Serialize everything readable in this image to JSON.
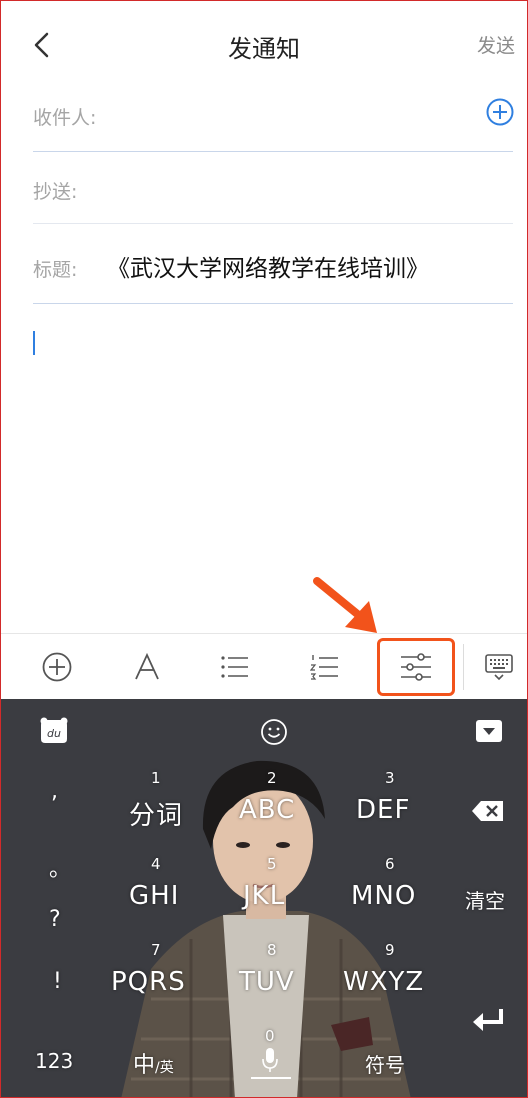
{
  "header": {
    "title": "发通知",
    "send_label": "发送"
  },
  "form": {
    "recipient_label": "收件人:",
    "cc_label": "抄送:",
    "subject_label": "标题:",
    "subject_value": "《武汉大学网络教学在线培训》"
  },
  "toolbar": {
    "icons": [
      "add-circle-icon",
      "font-style-icon",
      "bullet-list-icon",
      "numbered-list-icon",
      "settings-sliders-icon",
      "keyboard-toggle-icon"
    ],
    "highlight_color": "#f2531b"
  },
  "keyboard": {
    "punct": [
      ",",
      "。",
      "?",
      "!"
    ],
    "keys": [
      {
        "num": "1",
        "label": "分词"
      },
      {
        "num": "2",
        "label": "ABC"
      },
      {
        "num": "3",
        "label": "DEF"
      },
      {
        "num": "4",
        "label": "GHI"
      },
      {
        "num": "5",
        "label": "JKL"
      },
      {
        "num": "6",
        "label": "MNO"
      },
      {
        "num": "7",
        "label": "PQRS"
      },
      {
        "num": "8",
        "label": "TUV"
      },
      {
        "num": "9",
        "label": "WXYZ"
      }
    ],
    "clear_label": "清空",
    "num_switch_label": "123",
    "lang_switch_main": "中",
    "lang_switch_sub": "/英",
    "zero_label": "0",
    "symbol_label": "符号",
    "logo_text": "du",
    "accent_color": "#2f7fe0"
  }
}
